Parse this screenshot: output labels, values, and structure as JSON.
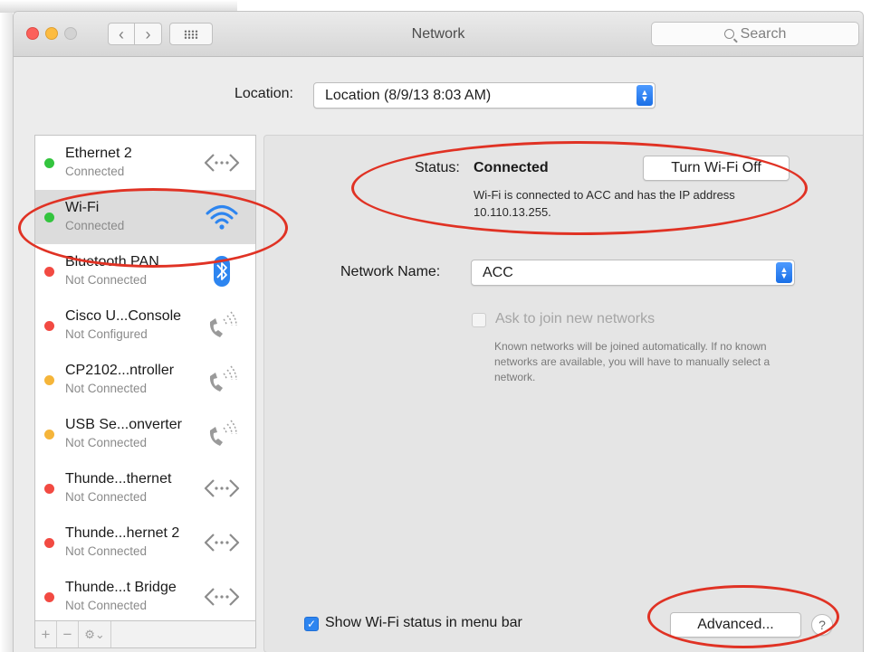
{
  "window": {
    "title": "Network"
  },
  "toolbar": {
    "back_glyph": "‹",
    "forward_glyph": "›",
    "search_placeholder": "Search"
  },
  "location": {
    "label": "Location:",
    "value": "Location (8/9/13 8:03 AM)"
  },
  "services": [
    {
      "name": "Ethernet 2",
      "status": "Connected",
      "dot": "green",
      "icon": "ethernet-icon"
    },
    {
      "name": "Wi-Fi",
      "status": "Connected",
      "dot": "green",
      "icon": "wifi-icon",
      "selected": true
    },
    {
      "name": "Bluetooth PAN",
      "status": "Not Connected",
      "dot": "red",
      "icon": "bluetooth-icon"
    },
    {
      "name": "Cisco U...Console",
      "status": "Not Configured",
      "dot": "red",
      "icon": "phone-icon"
    },
    {
      "name": "CP2102...ntroller",
      "status": "Not Connected",
      "dot": "amber",
      "icon": "phone-icon"
    },
    {
      "name": "USB Se...onverter",
      "status": "Not Connected",
      "dot": "amber",
      "icon": "phone-icon"
    },
    {
      "name": "Thunde...thernet",
      "status": "Not Connected",
      "dot": "red",
      "icon": "ethernet-icon"
    },
    {
      "name": "Thunde...hernet 2",
      "status": "Not Connected",
      "dot": "red",
      "icon": "ethernet-icon"
    },
    {
      "name": "Thunde...t Bridge",
      "status": "Not Connected",
      "dot": "red",
      "icon": "ethernet-icon"
    }
  ],
  "list_footer": {
    "add": "+",
    "remove": "−",
    "gear": "⚙⌄"
  },
  "detail": {
    "status_label": "Status:",
    "status_value": "Connected",
    "turn_off_button": "Turn Wi-Fi Off",
    "status_description": "Wi-Fi is connected to ACC and has the IP address 10.110.13.255.",
    "network_name_label": "Network Name:",
    "network_name_value": "ACC",
    "ask_join_label": "Ask to join new networks",
    "ask_join_checked": false,
    "ask_join_description": "Known networks will be joined automatically. If no known networks are available, you will have to manually select a network.",
    "show_status_label": "Show Wi-Fi status in menu bar",
    "show_status_checked": true,
    "advanced_button": "Advanced...",
    "help_button": "?"
  },
  "colors": {
    "status_green": "#33c43e",
    "status_red": "#f24a42",
    "status_amber": "#f5b53a",
    "accent_blue": "#2d85f0",
    "annotation_red": "#e03224"
  }
}
